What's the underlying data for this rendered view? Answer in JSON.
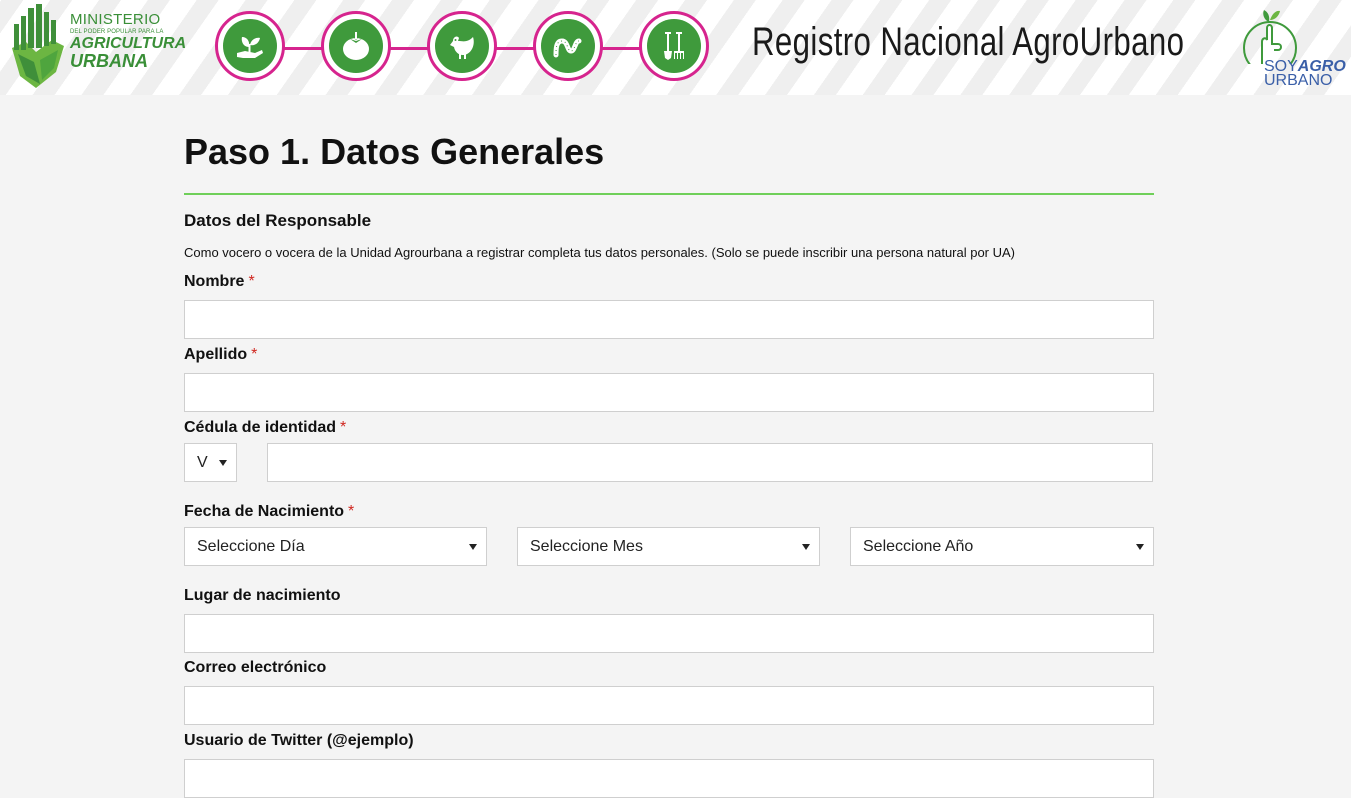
{
  "header": {
    "ministry_logo": {
      "line1": "MINISTERIO",
      "line2": "DEL PODER POPULAR PARA LA",
      "line3": "AGRICULTURA",
      "line4": "URBANA"
    },
    "icons": [
      "seedling-hand-icon",
      "tomato-icon",
      "hen-icon",
      "worm-icon",
      "garden-tools-icon"
    ],
    "title": "Registro Nacional AgroUrbano",
    "soy_logo": {
      "soy": "SOY",
      "agro": "AGRO",
      "urbano": "URBANO"
    },
    "colors": {
      "magenta": "#d6248e",
      "green": "#3f9a3c",
      "blue": "#3a5fa8"
    }
  },
  "form": {
    "heading": "Paso 1. Datos Generales",
    "section_title": "Datos del Responsable",
    "section_desc": "Como vocero o vocera de la Unidad Agrourbana a registrar completa tus datos personales. (Solo se puede inscribir una persona natural por UA)",
    "required_mark": "*",
    "fields": {
      "nombre": {
        "label": "Nombre",
        "value": ""
      },
      "apellido": {
        "label": "Apellido",
        "value": ""
      },
      "cedula": {
        "label": "Cédula de identidad",
        "prefix": "V",
        "value": ""
      },
      "fecha": {
        "label": "Fecha de Nacimiento",
        "dia": "Seleccione Día",
        "mes": "Seleccione Mes",
        "anio": "Seleccione Año"
      },
      "lugar": {
        "label": "Lugar de nacimiento",
        "value": ""
      },
      "correo": {
        "label": "Correo electrónico",
        "value": ""
      },
      "twitter": {
        "label": "Usuario de Twitter (@ejemplo)",
        "value": ""
      }
    },
    "accent_color": "#6fcf59",
    "required_color": "#d0261f"
  }
}
